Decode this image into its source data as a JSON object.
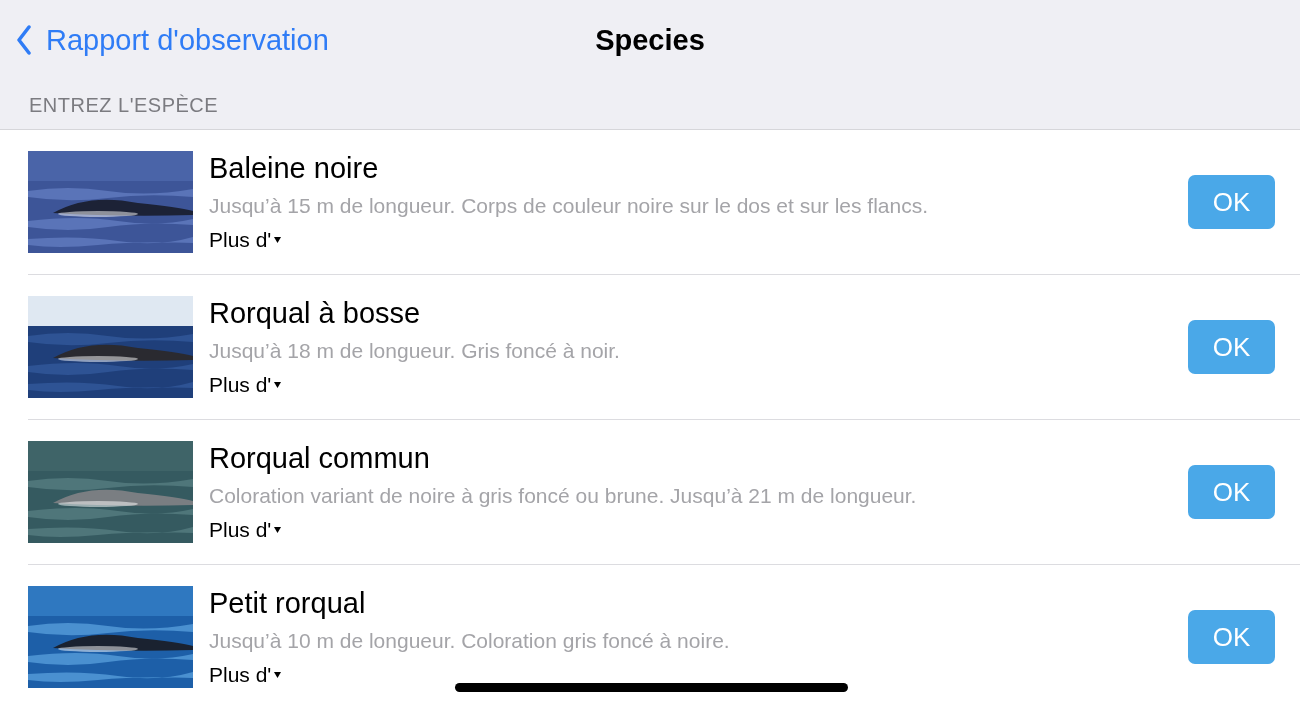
{
  "nav": {
    "back": "Rapport d'observation",
    "title": "Species"
  },
  "section": "ENTREZ L'ESPÈCE",
  "species": [
    {
      "name": "Baleine noire",
      "description": "Jusqu’à 15 m de longueur. Corps de couleur noire sur le dos et sur les flancs.",
      "more": "Plus d'",
      "button": "OK"
    },
    {
      "name": "Rorqual à bosse",
      "description": "Jusqu’à 18 m de longueur. Gris foncé à noir.",
      "more": "Plus d'",
      "button": "OK"
    },
    {
      "name": "Rorqual commun",
      "description": "Coloration variant de noire à gris foncé ou brune. Jusqu’à 21 m de longueur.",
      "more": "Plus d'",
      "button": "OK"
    },
    {
      "name": "Petit rorqual",
      "description": "Jusqu’à 10 m de longueur. Coloration gris foncé à noire.",
      "more": "Plus d'",
      "button": "OK"
    }
  ]
}
